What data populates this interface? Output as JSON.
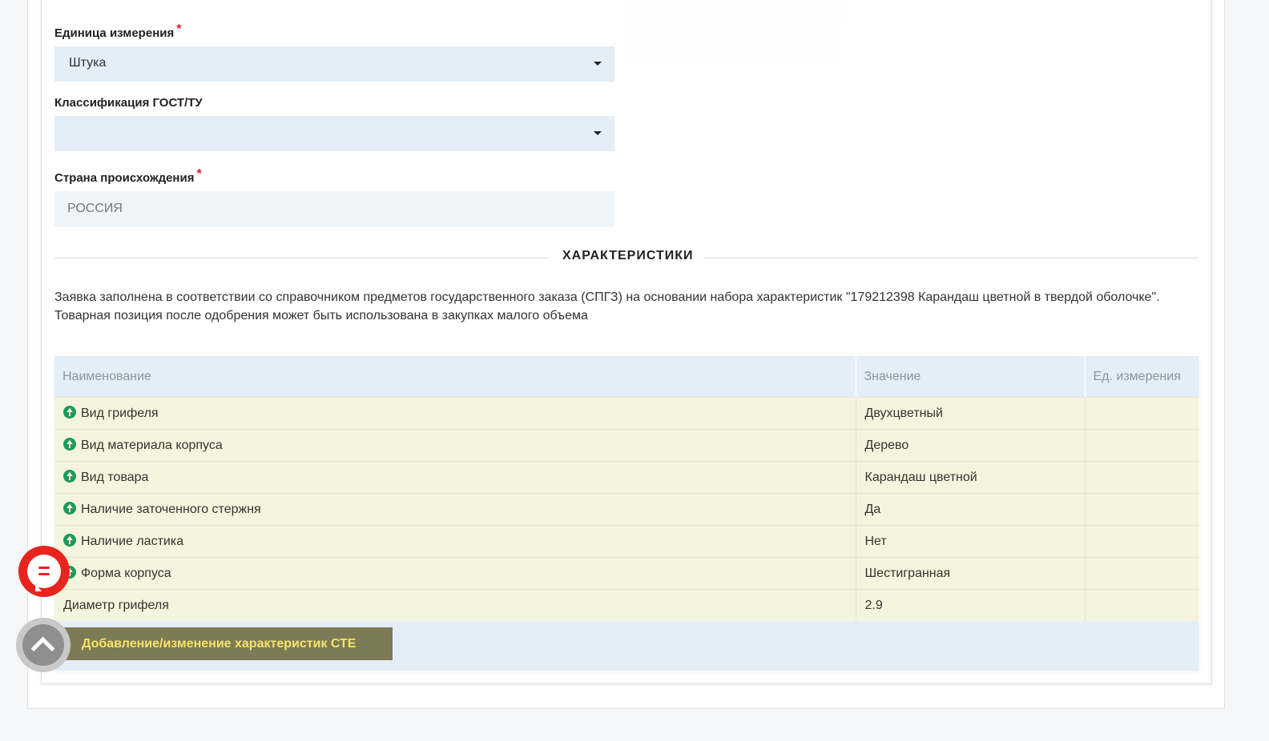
{
  "form": {
    "unit": {
      "label": "Единица измерения",
      "required_mark": "*",
      "value": "Штука"
    },
    "gost": {
      "label": "Классификация ГОСТ/ТУ",
      "value": ""
    },
    "country": {
      "label": "Страна происхождения",
      "required_mark": "*",
      "placeholder": "РОССИЯ"
    }
  },
  "section": {
    "title": "ХАРАКТЕРИСТИКИ",
    "note_line1": "Заявка заполнена в соответствии со справочником предметов государственного заказа (СПГЗ) на основании набора характеристик \"179212398 Карандаш цветной в твердой оболочке\".",
    "note_line2": "Товарная позиция после одобрения может быть использована в закупках малого объема"
  },
  "table": {
    "headers": [
      "Наименование",
      "Значение",
      "Ед. измерения"
    ],
    "rows": [
      {
        "name": "Вид грифеля",
        "value": "Двухцветный",
        "unit": "",
        "icon": "up-arrow-circle-icon"
      },
      {
        "name": "Вид материала корпуса",
        "value": "Дерево",
        "unit": "",
        "icon": "up-arrow-circle-icon"
      },
      {
        "name": "Вид товара",
        "value": "Карандаш цветной",
        "unit": "",
        "icon": "up-arrow-circle-icon"
      },
      {
        "name": "Наличие заточенного стержня",
        "value": "Да",
        "unit": "",
        "icon": "up-arrow-circle-icon"
      },
      {
        "name": "Наличие ластика",
        "value": "Нет",
        "unit": "",
        "icon": "up-arrow-circle-icon"
      },
      {
        "name": "Форма корпуса",
        "value": "Шестигранная",
        "unit": "",
        "icon": "up-arrow-circle-icon"
      },
      {
        "name": "Диаметр грифеля",
        "value": "2.9",
        "unit": "",
        "icon": ""
      }
    ],
    "action_button": "Добавление/изменение характеристик СТЕ"
  },
  "widgets": {
    "chat_icon": "chat-icon",
    "scroll_top_icon": "chevron-up-icon"
  },
  "colors": {
    "accent_red": "#e8241f",
    "field_bg": "#e4eef8",
    "row_bg": "#f5f4dc",
    "button_bg": "#7d7b55",
    "button_text": "#f5e36a",
    "icon_green": "#1e9a5a"
  }
}
